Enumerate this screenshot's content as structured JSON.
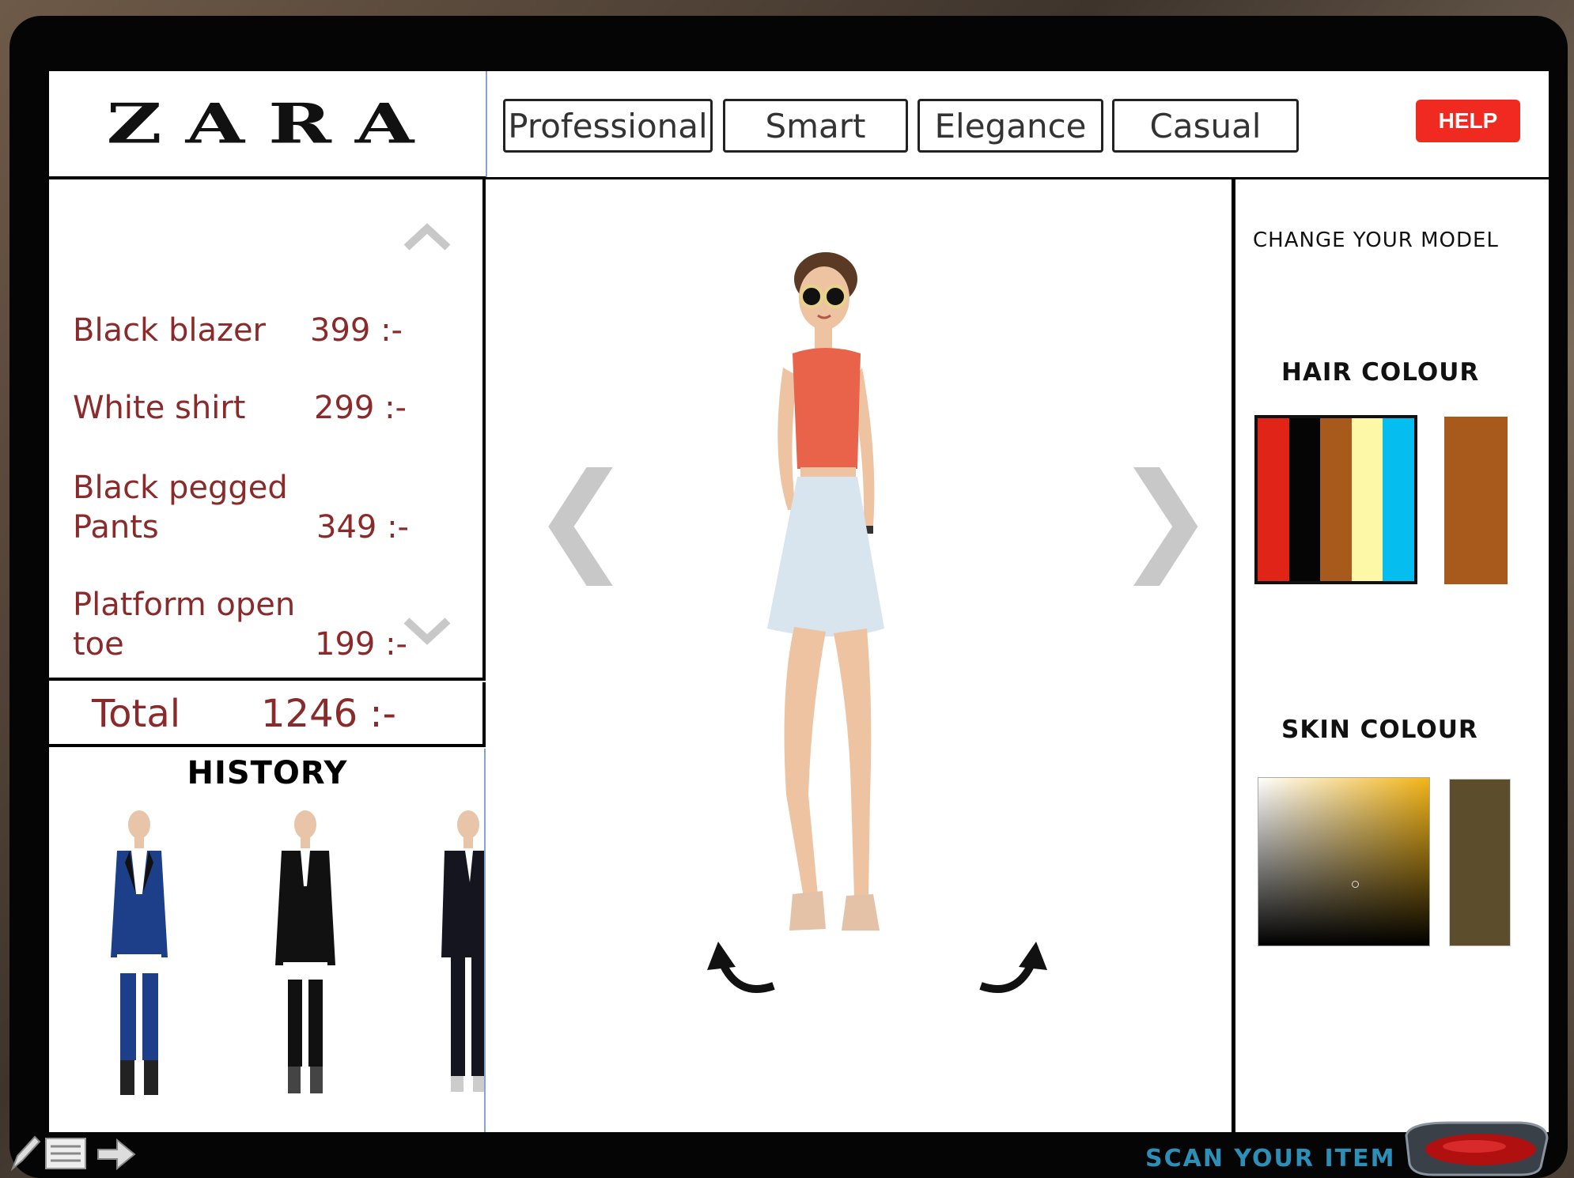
{
  "header": {
    "logo": "ZARA",
    "tabs": [
      "Professional",
      "Smart",
      "Elegance",
      "Casual"
    ],
    "help_label": "HELP"
  },
  "cart": {
    "items": [
      {
        "name": "Black blazer",
        "name2": "",
        "price": "399 :-"
      },
      {
        "name": "White shirt",
        "name2": "",
        "price": "299 :-"
      },
      {
        "name": "Black pegged",
        "name2": "Pants",
        "price": "349 :-"
      },
      {
        "name": "Platform open",
        "name2": "toe",
        "price": "199 :-"
      }
    ],
    "total_label": "Total",
    "total_value": "1246 :-"
  },
  "history": {
    "title": "HISTORY",
    "outfits": [
      "blue-blazer-outfit",
      "black-blazer-outfit",
      "black-suit-outfit"
    ]
  },
  "model": {
    "icon": "fashion-model-image"
  },
  "customize": {
    "title": "CHANGE YOUR MODEL",
    "hair_heading": "HAIR COLOUR",
    "hair_palette": [
      "#e02418",
      "#050505",
      "#a85a1c",
      "#fdf8a8",
      "#06bdf0"
    ],
    "hair_selected": "#a85a1c",
    "skin_heading": "SKIN COLOUR",
    "skin_selected": "#5c4d2c"
  },
  "bottom": {
    "scan_label": "SCAN YOUR ITEM"
  }
}
